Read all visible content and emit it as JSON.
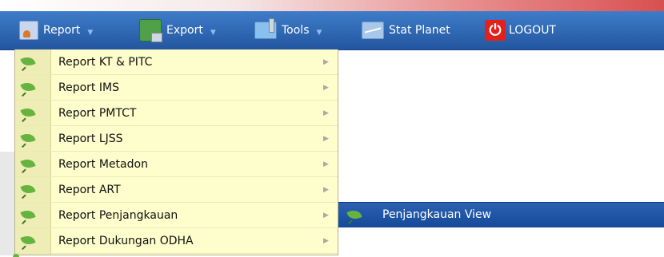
{
  "menubar": {
    "items": [
      {
        "label": "Report",
        "icon": "report-icon"
      },
      {
        "label": "Export",
        "icon": "export-icon"
      },
      {
        "label": "Tools",
        "icon": "tools-icon"
      },
      {
        "label": "Stat Planet",
        "icon": "stat-planet-icon"
      },
      {
        "label": "LOGOUT",
        "icon": "power-icon"
      }
    ],
    "colors": {
      "bar_top": "#3e7cc9",
      "bar_bottom": "#23569f",
      "logout_red": "#e3201b"
    }
  },
  "report_menu": {
    "items": [
      {
        "label": "Report KT & PITC"
      },
      {
        "label": "Report IMS"
      },
      {
        "label": "Report PMTCT"
      },
      {
        "label": "Report LJSS"
      },
      {
        "label": "Report Metadon"
      },
      {
        "label": "Report ART"
      },
      {
        "label": "Report Penjangkauan"
      },
      {
        "label": "Report Dukungan ODHA"
      }
    ],
    "colors": {
      "background": "#fefdcc",
      "gutter": "#eeedb5"
    }
  },
  "submenu": {
    "items": [
      {
        "label": "Penjangkauan View"
      }
    ],
    "colors": {
      "highlight": "#1a4e9d"
    }
  }
}
